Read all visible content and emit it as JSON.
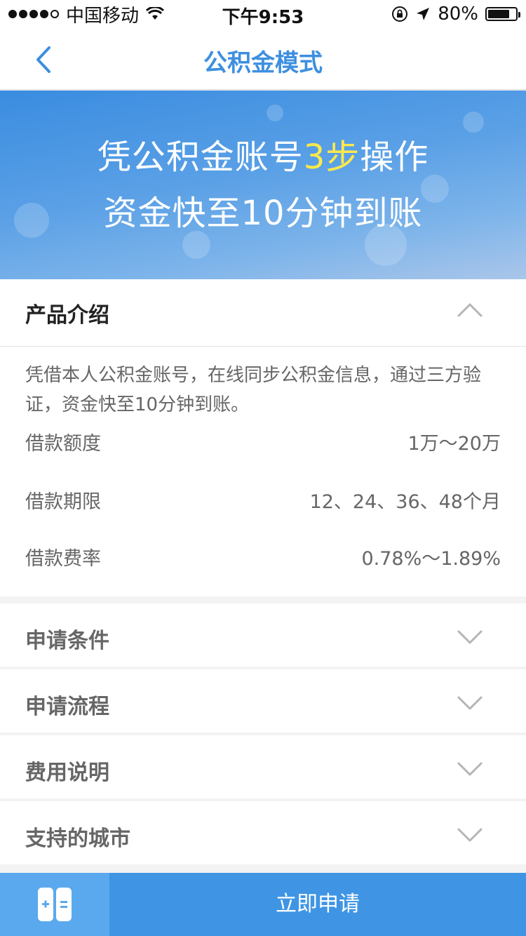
{
  "status_bar": {
    "carrier": "中国移动",
    "time": "下午9:53",
    "battery": "80%",
    "battery_level": 0.8,
    "signal_bars_filled": 4,
    "signal_bars_total": 5
  },
  "nav": {
    "title": "公积金模式"
  },
  "banner": {
    "line1_before": "凭公积金账号",
    "line1_highlight": "3步",
    "line1_after": "操作",
    "line2": "资金快至10分钟到账",
    "highlight_color": "#ffe94a"
  },
  "intro": {
    "title": "产品介绍",
    "description": "凭借本人公积金账号，在线同步公积金信息，通过三方验证，资金快至10分钟到账。",
    "rows": [
      {
        "label": "借款额度",
        "value": "1万～20万"
      },
      {
        "label": "借款期限",
        "value": "12、24、36、48个月"
      },
      {
        "label": "借款费率",
        "value": "0.78%～1.89%"
      }
    ]
  },
  "sections": [
    {
      "label": "申请条件"
    },
    {
      "label": "申请流程"
    },
    {
      "label": "费用说明"
    },
    {
      "label": "支持的城市"
    }
  ],
  "bottom": {
    "apply_label": "立即申请"
  },
  "colors": {
    "accent": "#3d8fe0",
    "apply_button": "#3f95e4",
    "calc_button": "#5aa9ee"
  }
}
